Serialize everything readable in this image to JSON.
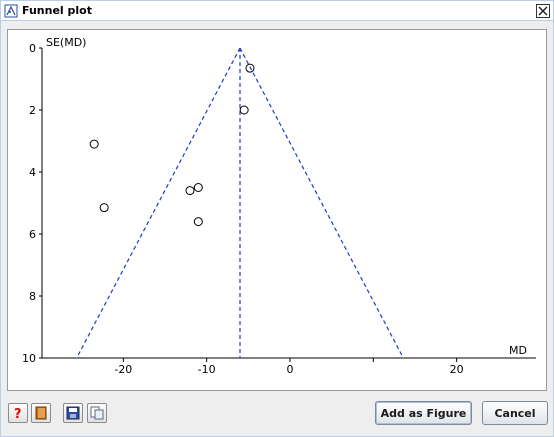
{
  "window": {
    "title": "Funnel plot"
  },
  "icons": {
    "app": "funnel-plot-app-icon",
    "close": "close-icon",
    "help": "help-icon",
    "book": "book-icon",
    "save": "save-icon",
    "copy": "copy-icon"
  },
  "buttons": {
    "add_as_figure": "Add as Figure",
    "cancel": "Cancel"
  },
  "chart_data": {
    "type": "scatter",
    "ylabel": "SE(MD)",
    "xlabel": "MD",
    "xlim": [
      -30,
      30
    ],
    "ylim": [
      10,
      0
    ],
    "y_reversed": true,
    "x_ticks": [
      "-20",
      "-10",
      "0",
      "20"
    ],
    "x_tick_values": [
      -20,
      -10,
      0,
      20
    ],
    "x_axis_unlabeled_ticks": [
      10
    ],
    "y_ticks": [
      "0",
      "2",
      "4",
      "6",
      "8",
      "10"
    ],
    "y_tick_values": [
      0,
      2,
      4,
      6,
      8,
      10
    ],
    "points": [
      {
        "x": -4.8,
        "y": 0.65
      },
      {
        "x": -5.5,
        "y": 2.0
      },
      {
        "x": -23.5,
        "y": 3.1
      },
      {
        "x": -22.3,
        "y": 5.15
      },
      {
        "x": -12.0,
        "y": 4.6
      },
      {
        "x": -11.0,
        "y": 4.5
      },
      {
        "x": -11.0,
        "y": 5.6
      }
    ],
    "pooled_estimate": -6.0,
    "funnel_limits": {
      "z": 1.96,
      "style": "dashed",
      "color": "#1f3ac7"
    },
    "grid": false,
    "marker": "open-circle"
  }
}
